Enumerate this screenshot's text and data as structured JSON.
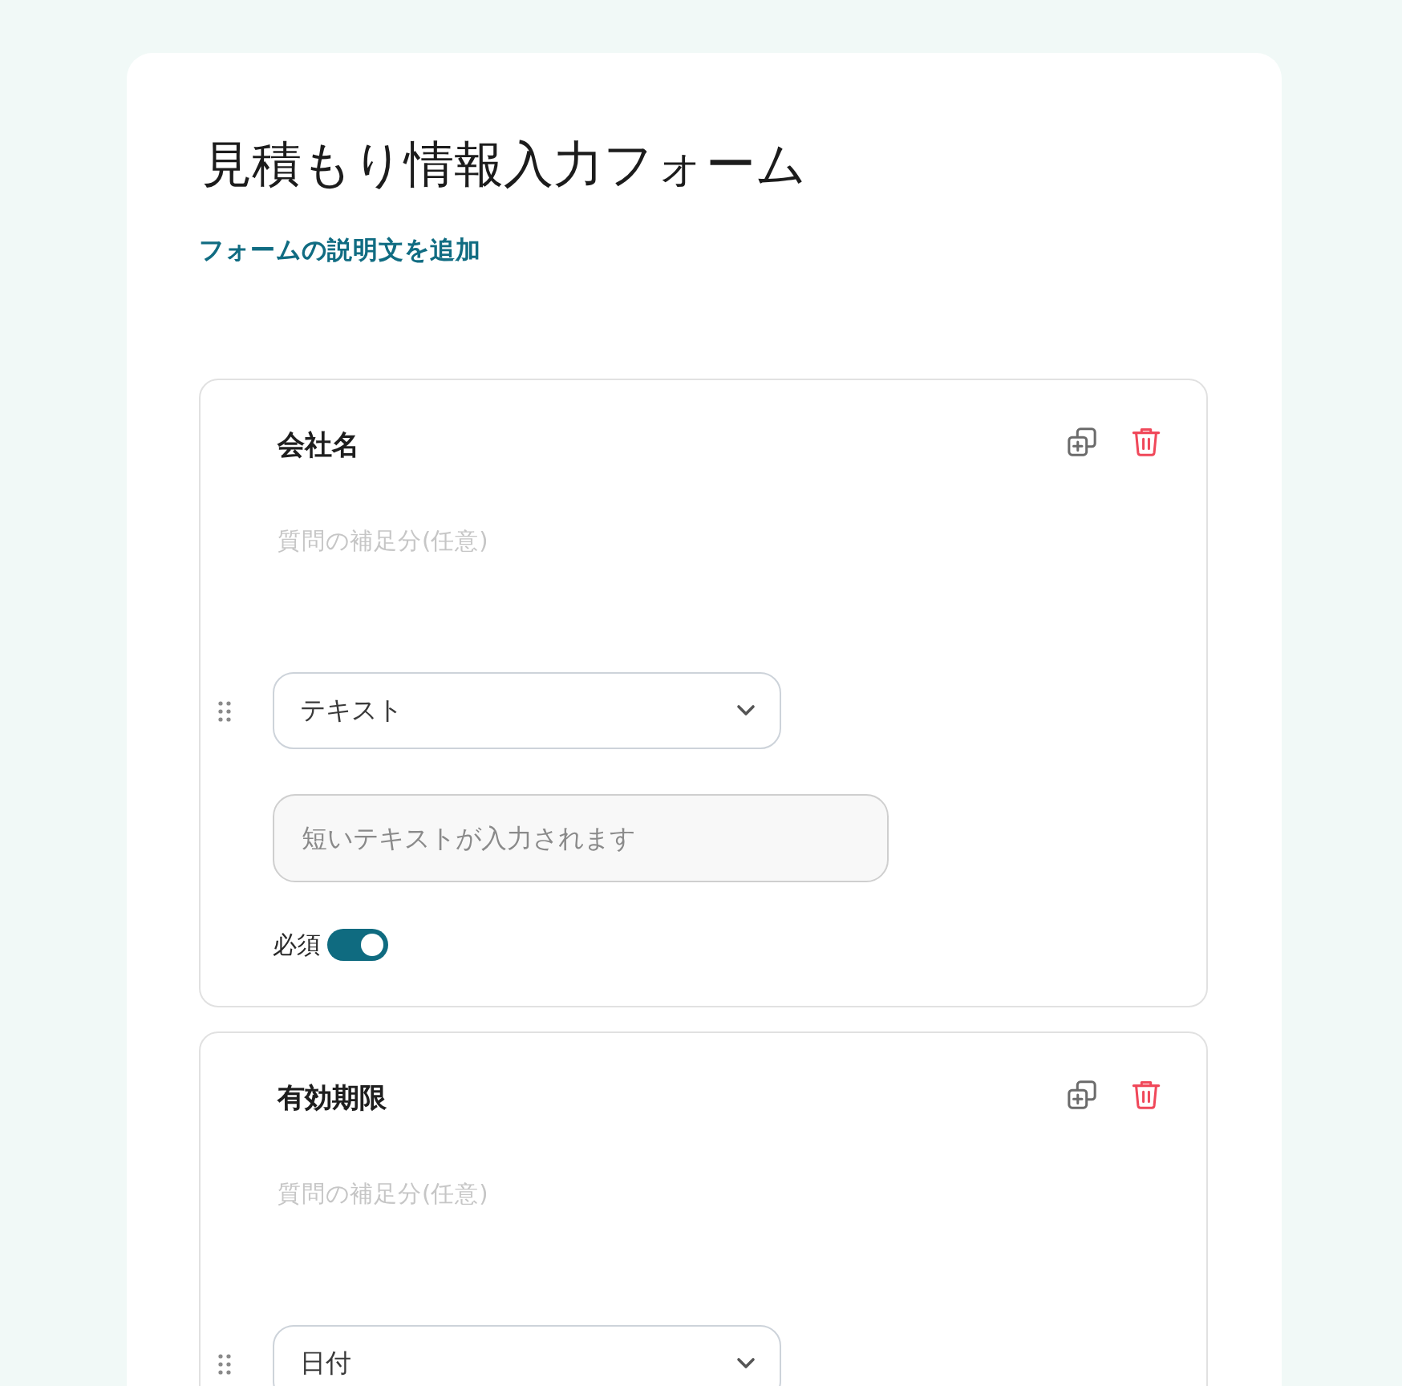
{
  "form": {
    "title": "見積もり情報入力フォーム",
    "add_description_link": "フォームの説明文を追加"
  },
  "questions": [
    {
      "title": "会社名",
      "help_field": {
        "placeholder": "質問の補足分(任意)"
      },
      "type_select": {
        "value": "テキスト"
      },
      "answer_field": {
        "placeholder": "短いテキストが入力されます"
      },
      "required_label": "必須",
      "required": true
    },
    {
      "title": "有効期限",
      "help_field": {
        "placeholder": "質問の補足分(任意)"
      },
      "type_select": {
        "value": "日付"
      }
    }
  ]
}
